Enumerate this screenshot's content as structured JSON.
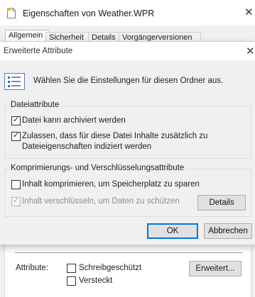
{
  "background_window": {
    "title": "Eigenschaften von Weather.WPR",
    "tabs": [
      "Allgemein",
      "Sicherheit",
      "Details",
      "Vorgängerversionen"
    ],
    "attributes_label": "Attribute:",
    "checkbox_readonly": "Schreibgeschützt",
    "checkbox_hidden": "Versteckt",
    "advanced_button": "Erweitert..."
  },
  "dialog": {
    "title": "Erweiterte Attribute",
    "header_text": "Wählen Sie die Einstellungen für diesen Ordner aus.",
    "file_attributes": {
      "title": "Dateiattribute",
      "archive_label": "Datei kann archiviert werden",
      "archive_checked": true,
      "index_label_line1": "Zulassen, dass für diese Datei Inhalte zusätzlich zu",
      "index_label_line2": "Dateieigenschaften indiziert werden",
      "index_checked": true
    },
    "compress_encrypt": {
      "title": "Komprimierungs- und Verschlüsselungsattribute",
      "compress_label": "Inhalt komprimieren, um Speicherplatz zu sparen",
      "compress_checked": false,
      "encrypt_label": "Inhalt verschlüsseln, um Daten zu schützen",
      "encrypt_checked": true,
      "details_button": "Details"
    },
    "ok_button": "OK",
    "cancel_button": "Abbrechen"
  }
}
